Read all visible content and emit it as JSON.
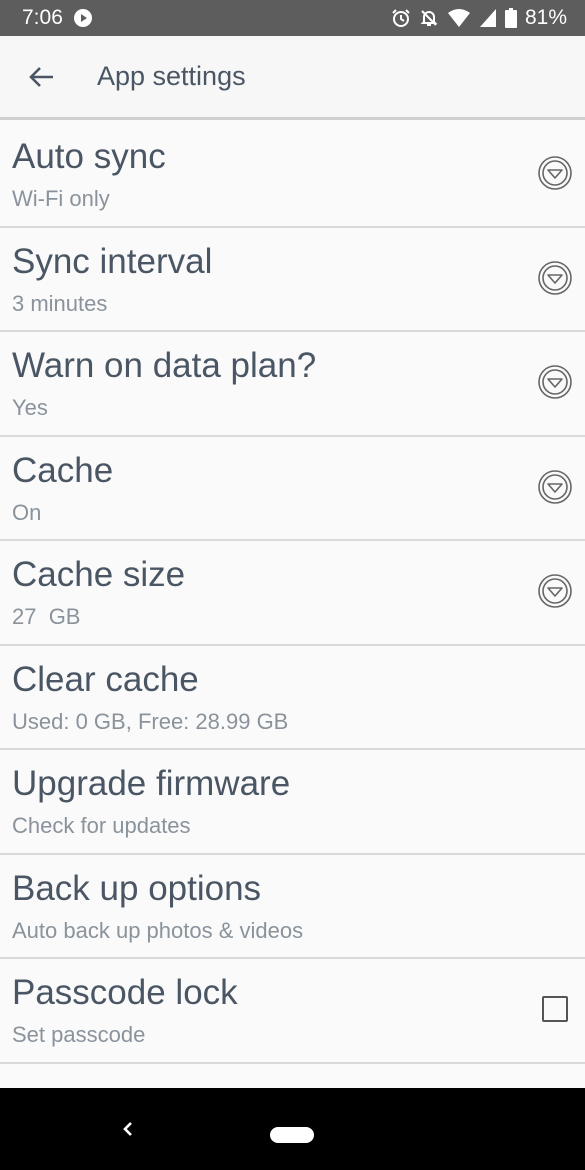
{
  "status_bar": {
    "time": "7:06",
    "battery": "81%",
    "icons": [
      "media-icon",
      "alarm-icon",
      "notifications-off-icon",
      "wifi-icon",
      "signal-icon",
      "battery-icon"
    ]
  },
  "app_bar": {
    "title": "App settings",
    "back_icon": "back-arrow-icon"
  },
  "settings": [
    {
      "title": "Auto sync",
      "subtitle": "Wi-Fi only",
      "control": "dropdown"
    },
    {
      "title": "Sync interval",
      "subtitle": "3 minutes",
      "control": "dropdown"
    },
    {
      "title": "Warn on data plan?",
      "subtitle": "Yes",
      "control": "dropdown"
    },
    {
      "title": "Cache",
      "subtitle": "On",
      "control": "dropdown"
    },
    {
      "title": "Cache size",
      "subtitle": "27  GB",
      "control": "dropdown"
    },
    {
      "title": "Clear cache",
      "subtitle": "Used: 0 GB, Free: 28.99 GB",
      "control": "none"
    },
    {
      "title": "Upgrade firmware",
      "subtitle": "Check for updates",
      "control": "none"
    },
    {
      "title": "Back up options",
      "subtitle": "Auto back up photos & videos",
      "control": "none"
    },
    {
      "title": "Passcode lock",
      "subtitle": "Set passcode",
      "control": "checkbox",
      "checked": false
    }
  ],
  "colors": {
    "status_bar": "#5d5d5d",
    "title_text": "#4a5664",
    "subtitle_text": "#8a939b",
    "background": "#fafafa"
  }
}
